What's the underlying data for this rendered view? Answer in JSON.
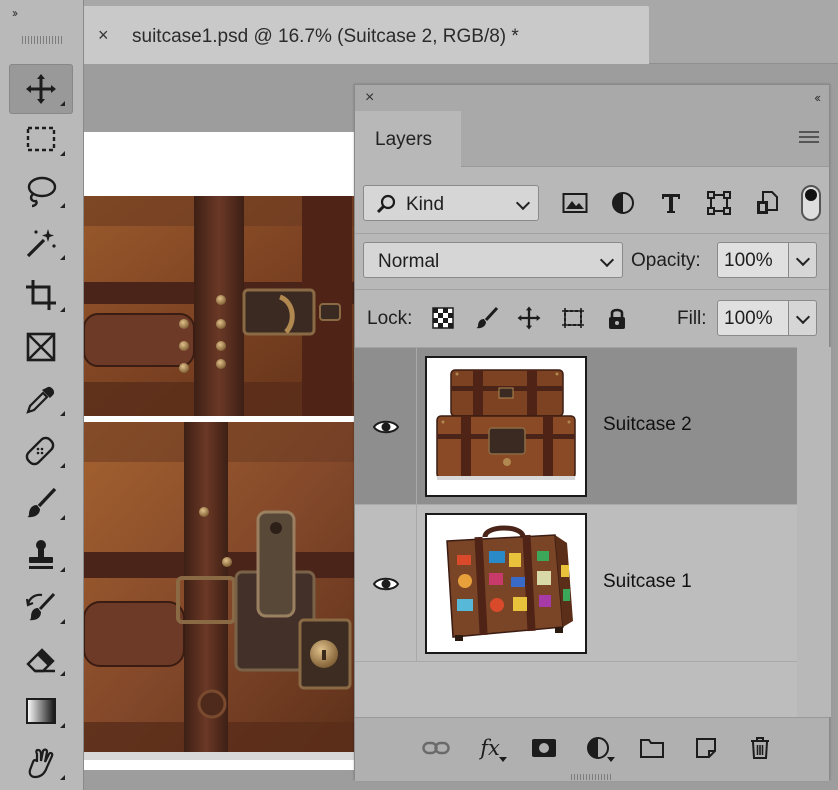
{
  "document": {
    "tab_title": "suitcase1.psd @ 16.7% (Suitcase 2, RGB/8) *",
    "close_glyph": "×"
  },
  "toolbar": {
    "collapse_glyph": "››",
    "tools": [
      {
        "name": "move-tool",
        "icon": "move-icon",
        "active": true
      },
      {
        "name": "rectangular-marquee-tool",
        "icon": "marquee-icon"
      },
      {
        "name": "lasso-tool",
        "icon": "lasso-icon"
      },
      {
        "name": "magic-wand-tool",
        "icon": "magic-wand-icon"
      },
      {
        "name": "crop-tool",
        "icon": "crop-icon"
      },
      {
        "name": "frame-tool",
        "icon": "frame-icon"
      },
      {
        "name": "eyedropper-tool",
        "icon": "eyedropper-icon"
      },
      {
        "name": "spot-healing-tool",
        "icon": "bandage-icon"
      },
      {
        "name": "brush-tool",
        "icon": "brush-icon"
      },
      {
        "name": "clone-stamp-tool",
        "icon": "stamp-icon"
      },
      {
        "name": "history-brush-tool",
        "icon": "history-brush-icon"
      },
      {
        "name": "eraser-tool",
        "icon": "eraser-icon"
      },
      {
        "name": "gradient-tool",
        "icon": "gradient-icon"
      },
      {
        "name": "smudge-tool",
        "icon": "smudge-icon"
      }
    ]
  },
  "panel": {
    "close_glyph": "×",
    "collapse_glyph": "‹‹",
    "tab_label": "Layers",
    "filter": {
      "kind_label": "Kind"
    },
    "blend_mode": "Normal",
    "opacity_label": "Opacity:",
    "opacity_value": "100%",
    "lock_label": "Lock:",
    "fill_label": "Fill:",
    "fill_value": "100%",
    "layers": [
      {
        "name": "Suitcase 2",
        "selected": true,
        "visible": true
      },
      {
        "name": "Suitcase 1",
        "selected": false,
        "visible": true
      }
    ],
    "footer_fx_label": "fx"
  },
  "colors": {
    "leather_dark": "#4a2a1c",
    "leather_mid": "#7a4426",
    "leather_light": "#a5622f",
    "brass": "#b08850",
    "selected_row": "#8e8e8e"
  }
}
